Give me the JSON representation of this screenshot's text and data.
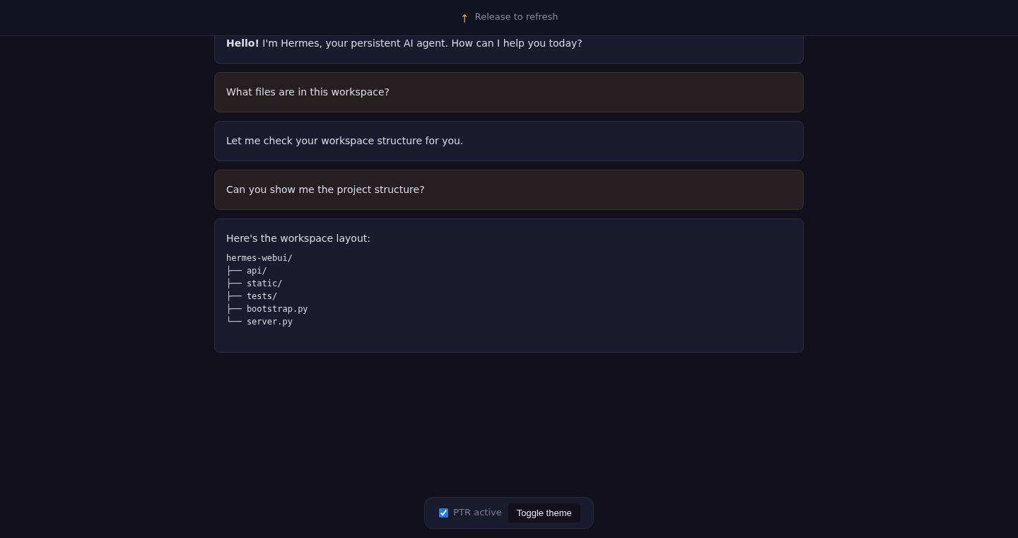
{
  "refresh_indicator": {
    "arrow": "↑",
    "label": "Release to refresh"
  },
  "messages": [
    {
      "kind": "assistant",
      "text": "**Hello!** I'm Hermes, your persistent AI agent. How can I help you today?"
    },
    {
      "kind": "user",
      "text": "What files are in this workspace?"
    },
    {
      "kind": "assistant",
      "text": "Let me check your workspace structure for you."
    },
    {
      "kind": "user",
      "text": "Can you show me the project structure?"
    },
    {
      "kind": "assistant",
      "text": "Here's the workspace layout:",
      "code": "hermes-webui/\n├── api/\n├── static/\n├── tests/\n├── bootstrap.py\n└── server.py"
    }
  ],
  "controls": {
    "ptr_active": {
      "label": "PTR active",
      "checked": true
    },
    "toggle_theme": {
      "label": "Toggle theme"
    }
  }
}
